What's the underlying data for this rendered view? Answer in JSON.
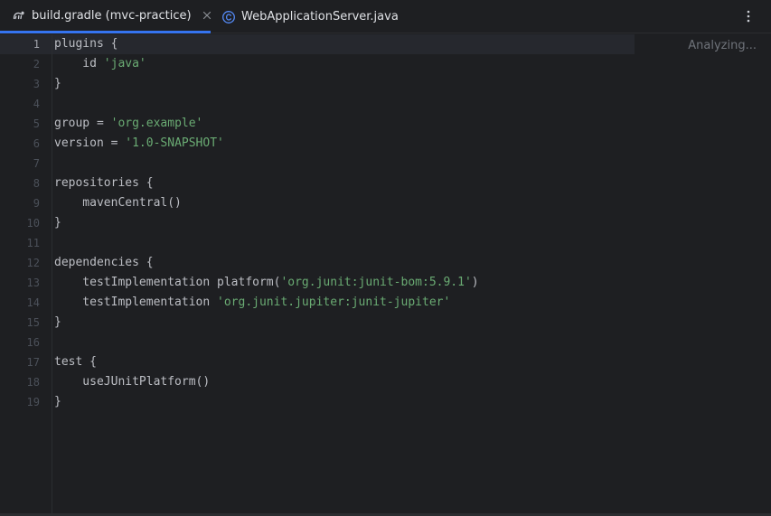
{
  "tabs": [
    {
      "label": "build.gradle (mvc-practice)",
      "icon": "gradle-icon",
      "active": true
    },
    {
      "label": "WebApplicationServer.java",
      "icon": "java-class-icon",
      "active": false
    }
  ],
  "status": {
    "analyzing": "Analyzing..."
  },
  "editor": {
    "current_line": 1,
    "lines": [
      {
        "n": "1",
        "tokens": [
          {
            "t": "plugins {",
            "c": "plain"
          }
        ]
      },
      {
        "n": "2",
        "tokens": [
          {
            "t": "    id ",
            "c": "plain"
          },
          {
            "t": "'java'",
            "c": "str"
          }
        ]
      },
      {
        "n": "3",
        "tokens": [
          {
            "t": "}",
            "c": "plain"
          }
        ]
      },
      {
        "n": "4",
        "tokens": []
      },
      {
        "n": "5",
        "tokens": [
          {
            "t": "group = ",
            "c": "plain"
          },
          {
            "t": "'org.example'",
            "c": "str"
          }
        ]
      },
      {
        "n": "6",
        "tokens": [
          {
            "t": "version = ",
            "c": "plain"
          },
          {
            "t": "'1.0-SNAPSHOT'",
            "c": "str"
          }
        ]
      },
      {
        "n": "7",
        "tokens": []
      },
      {
        "n": "8",
        "tokens": [
          {
            "t": "repositories {",
            "c": "plain"
          }
        ]
      },
      {
        "n": "9",
        "tokens": [
          {
            "t": "    mavenCentral()",
            "c": "plain"
          }
        ]
      },
      {
        "n": "10",
        "tokens": [
          {
            "t": "}",
            "c": "plain"
          }
        ]
      },
      {
        "n": "11",
        "tokens": []
      },
      {
        "n": "12",
        "tokens": [
          {
            "t": "dependencies {",
            "c": "plain"
          }
        ]
      },
      {
        "n": "13",
        "tokens": [
          {
            "t": "    testImplementation platform(",
            "c": "plain"
          },
          {
            "t": "'org.junit:junit-bom:5.9.1'",
            "c": "str"
          },
          {
            "t": ")",
            "c": "plain"
          }
        ]
      },
      {
        "n": "14",
        "tokens": [
          {
            "t": "    testImplementation ",
            "c": "plain"
          },
          {
            "t": "'org.junit.jupiter:junit-jupiter'",
            "c": "str"
          }
        ]
      },
      {
        "n": "15",
        "tokens": [
          {
            "t": "}",
            "c": "plain"
          }
        ]
      },
      {
        "n": "16",
        "tokens": []
      },
      {
        "n": "17",
        "tokens": [
          {
            "t": "test {",
            "c": "plain"
          }
        ]
      },
      {
        "n": "18",
        "tokens": [
          {
            "t": "    useJUnitPlatform()",
            "c": "plain"
          }
        ]
      },
      {
        "n": "19",
        "tokens": [
          {
            "t": "}",
            "c": "plain"
          }
        ]
      }
    ]
  },
  "colors": {
    "background": "#1e1f22",
    "accent": "#3574f0",
    "string": "#6aab73",
    "text": "#bcbec4",
    "line_number": "#4b5059"
  }
}
